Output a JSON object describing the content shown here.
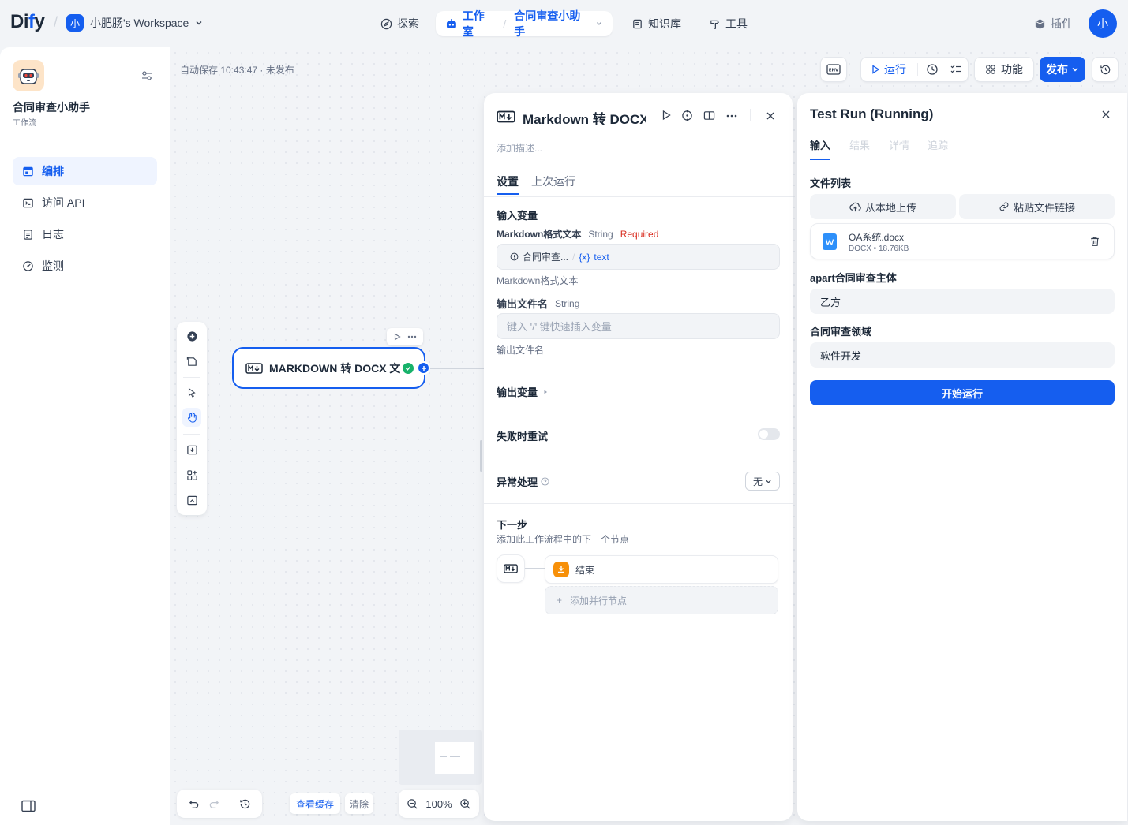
{
  "brand": {
    "logo": "Dify"
  },
  "workspace": {
    "badge": "小",
    "name": "小肥肠's Workspace"
  },
  "nav": {
    "explore": "探索",
    "studio": "工作室",
    "app_name": "合同审查小助手",
    "knowledge": "知识库",
    "tools": "工具",
    "plugins": "插件",
    "avatar": "小"
  },
  "sidebar": {
    "app_title": "合同审查小助手",
    "app_type": "工作流",
    "items": [
      {
        "label": "编排",
        "icon": "layout-icon"
      },
      {
        "label": "访问 API",
        "icon": "terminal-icon"
      },
      {
        "label": "日志",
        "icon": "document-icon"
      },
      {
        "label": "监测",
        "icon": "gauge-icon"
      }
    ]
  },
  "canvas": {
    "autosave": "自动保存 10:43:47 · 未发布",
    "node_title": "MARKDOWN 转 DOCX 文",
    "cache_view": "查看缓存",
    "cache_clear": "清除",
    "zoom": "100%"
  },
  "toolbar": {
    "env": "ENV",
    "run": "运行",
    "features": "功能",
    "publish": "发布"
  },
  "node_panel": {
    "title": "Markdown 转 DOCX",
    "description_placeholder": "添加描述...",
    "tabs": [
      "设置",
      "上次运行"
    ],
    "input_vars_label": "输入变量",
    "var1_name": "Markdown格式文本",
    "var1_type": "String",
    "var1_required": "Required",
    "var1_ref_node": "合同审查...",
    "var1_ref_var": "text",
    "var1_desc": "Markdown格式文本",
    "var2_name": "输出文件名",
    "var2_type": "String",
    "var2_placeholder": "键入 '/' 键快速插入变量",
    "var2_desc": "输出文件名",
    "output_vars": "输出变量",
    "retry": "失败时重试",
    "error_handling": "异常处理",
    "error_value": "无",
    "next_step": "下一步",
    "next_step_desc": "添加此工作流程中的下一个节点",
    "next_node": "结束",
    "add_parallel": "添加并行节点"
  },
  "run_panel": {
    "title": "Test Run (Running)",
    "tabs": [
      "输入",
      "结果",
      "详情",
      "追踪"
    ],
    "file_list_label": "文件列表",
    "upload_local": "从本地上传",
    "paste_link": "粘贴文件链接",
    "file_name": "OA系统.docx",
    "file_meta": "DOCX • 18.76KB",
    "field1_label": "apart合同审查主体",
    "field1_value": "乙方",
    "field2_label": "合同审查领域",
    "field2_value": "软件开发",
    "start_button": "开始运行"
  },
  "colors": {
    "primary": "#155eef",
    "end_node": "#f79009",
    "success": "#17b26a",
    "word": "#2e90fa"
  }
}
